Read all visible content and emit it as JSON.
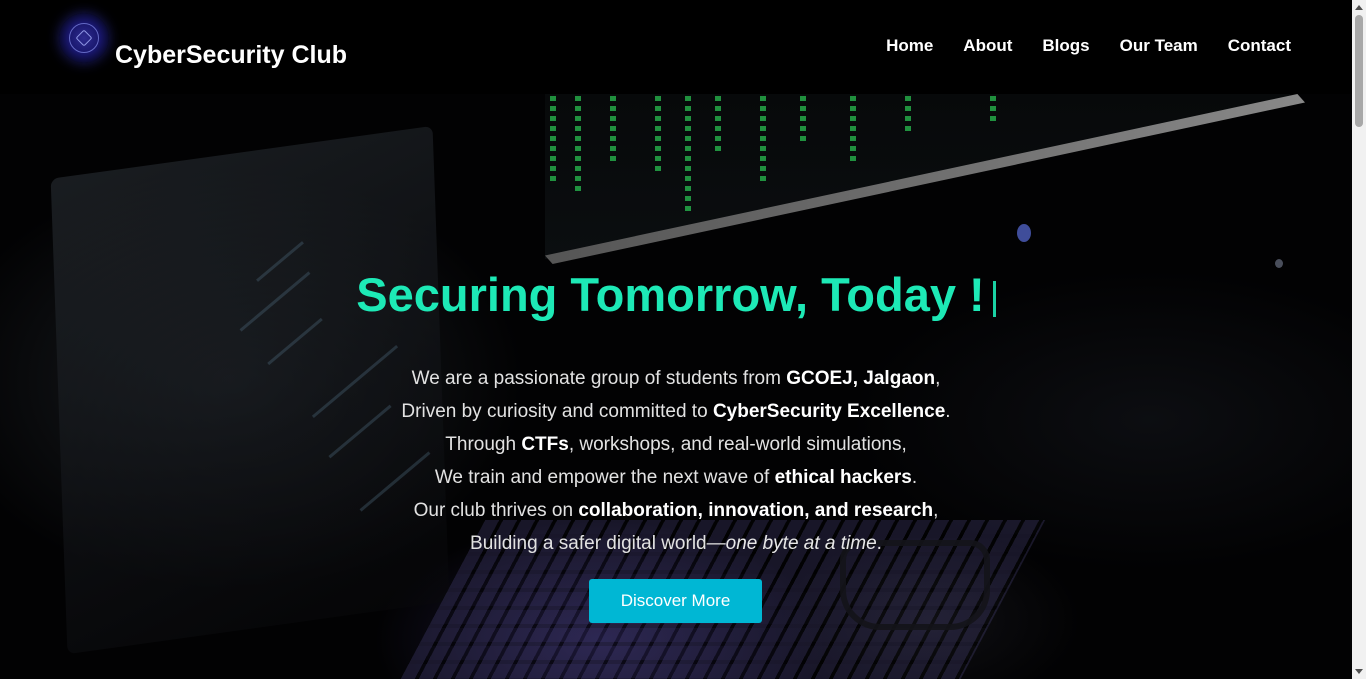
{
  "header": {
    "logo_icon": "cybersecurity-club-emblem",
    "brand": "CyberSecurity Club",
    "nav": {
      "home": "Home",
      "about": "About",
      "blogs": "Blogs",
      "our_team": "Our Team",
      "contact": "Contact"
    }
  },
  "hero": {
    "headline": "Securing Tomorrow, Today !",
    "line1": {
      "a": "We are a passionate group of students from ",
      "b": "GCOEJ, Jalgaon",
      "c": ","
    },
    "line2": {
      "a": "Driven by curiosity and committed to ",
      "b": "CyberSecurity Excellence",
      "c": "."
    },
    "line3": {
      "a": "Through ",
      "b": "CTFs",
      "c": ", workshops, and real-world simulations,"
    },
    "line4": {
      "a": "We train and empower the next wave of ",
      "b": "ethical hackers",
      "c": "."
    },
    "line5": {
      "a": "Our club thrives on ",
      "b": "collaboration, innovation, and research",
      "c": ","
    },
    "line6": {
      "a": "Building a safer digital world—",
      "i": "one byte at a time",
      "c": "."
    },
    "cta_label": "Discover More"
  },
  "colors": {
    "accent": "#1de9b6",
    "button": "#00b7d4",
    "header_bg": "#000000",
    "text": "#e2e2e2"
  }
}
